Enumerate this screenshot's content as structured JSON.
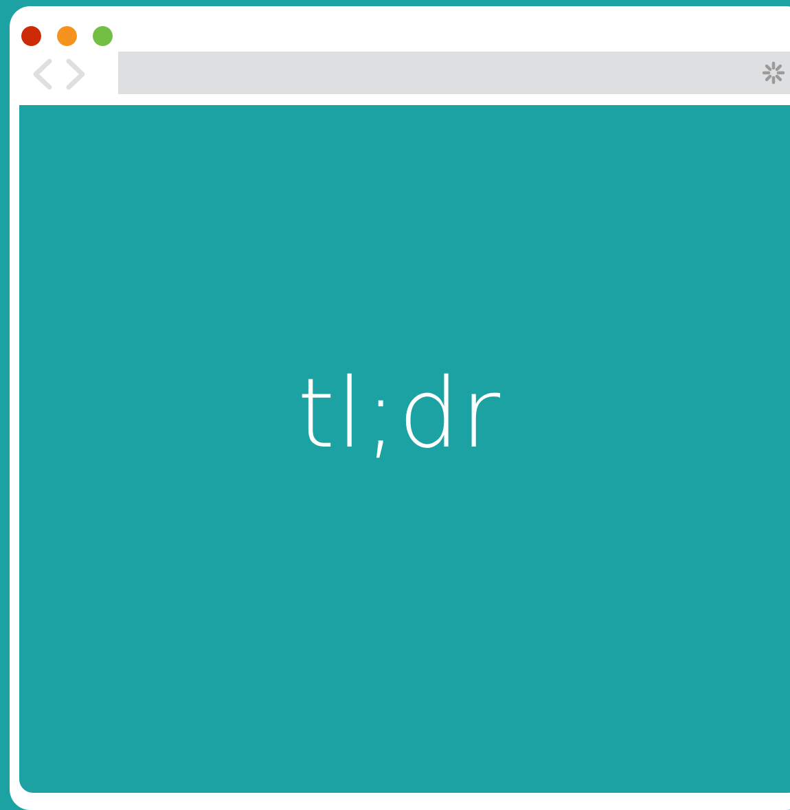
{
  "colors": {
    "background": "#1ca2a3",
    "window": "#ffffff",
    "close_dot": "#cd2a08",
    "minimize_dot": "#f6931e",
    "zoom_dot": "#72bf44",
    "address_bar": "#dedfe1",
    "nav_arrow": "#dedfe1",
    "spinner": "#9a9a9a",
    "content": "#1ca2a3"
  },
  "toolbar": {
    "back_icon": "chevron-left-icon",
    "forward_icon": "chevron-right-icon",
    "address_value": "",
    "loading_icon": "spinner-icon"
  },
  "content": {
    "heading": "tl;dr"
  }
}
